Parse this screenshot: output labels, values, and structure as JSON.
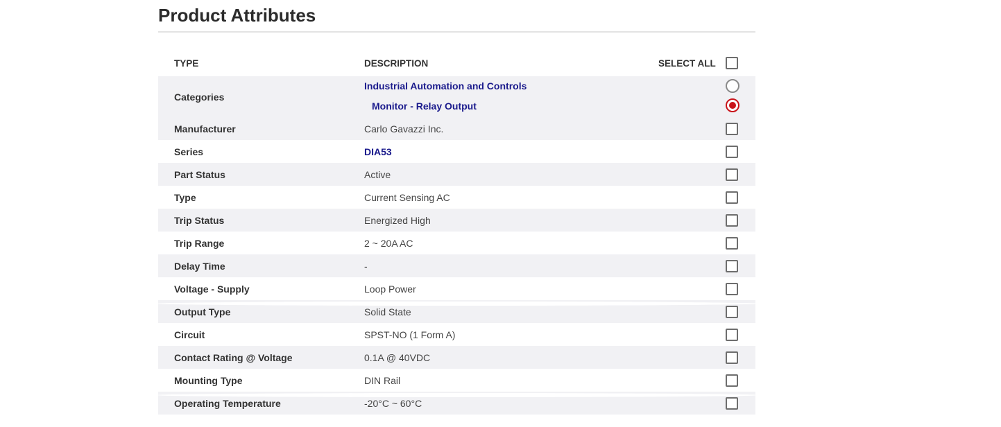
{
  "page_title": "Product Attributes",
  "header": {
    "type": "TYPE",
    "description": "DESCRIPTION",
    "select_all": "SELECT ALL"
  },
  "categories": {
    "label": "Categories",
    "items": [
      "Industrial Automation and Controls",
      "Monitor - Relay Output"
    ],
    "selected_index": 1
  },
  "rows": [
    {
      "type": "Manufacturer",
      "description": "Carlo Gavazzi Inc.",
      "link": false
    },
    {
      "type": "Series",
      "description": "DIA53",
      "link": true
    },
    {
      "type": "Part Status",
      "description": "Active",
      "link": false
    },
    {
      "type": "Type",
      "description": "Current Sensing AC",
      "link": false
    },
    {
      "type": "Trip Status",
      "description": "Energized High",
      "link": false
    },
    {
      "type": "Trip Range",
      "description": "2 ~ 20A AC",
      "link": false
    },
    {
      "type": "Delay Time",
      "description": "-",
      "link": false
    },
    {
      "type": "Voltage - Supply",
      "description": "Loop Power",
      "link": false
    },
    {
      "type": "Output Type",
      "description": "Solid State",
      "link": false
    },
    {
      "type": "Circuit",
      "description": "SPST-NO (1 Form A)",
      "link": false
    },
    {
      "type": "Contact Rating @ Voltage",
      "description": "0.1A @ 40VDC",
      "link": false
    },
    {
      "type": "Mounting Type",
      "description": "DIN Rail",
      "link": false
    },
    {
      "type": "Operating Temperature",
      "description": "-20°C ~ 60°C",
      "link": false
    }
  ],
  "colors": {
    "link": "#1a1a8c",
    "radio_selected": "#c9141a",
    "row_alt": "#f1f1f4"
  }
}
